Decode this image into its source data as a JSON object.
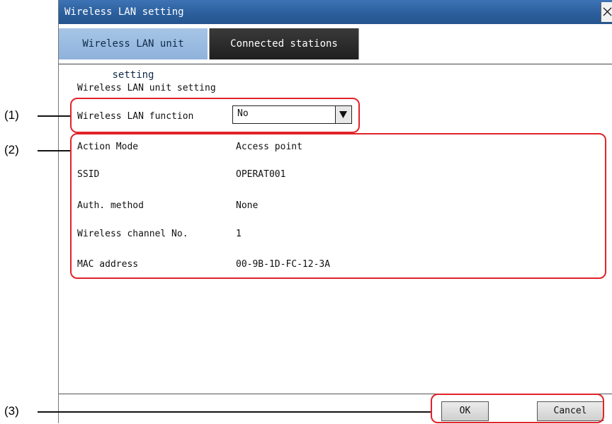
{
  "window": {
    "title": "Wireless LAN setting"
  },
  "tabs": [
    {
      "label": "Wireless LAN unit setting",
      "active": true
    },
    {
      "label": "Connected stations",
      "active": false
    }
  ],
  "section_title": "Wireless LAN unit setting",
  "wireless_function": {
    "label": "Wireless LAN function",
    "value": "No"
  },
  "info_rows": [
    {
      "label": "Action Mode",
      "value": "Access point"
    },
    {
      "label": "SSID",
      "value": "OPERAT001"
    },
    {
      "label": "Auth. method",
      "value": "None"
    },
    {
      "label": "Wireless channel No.",
      "value": "1"
    },
    {
      "label": "MAC address",
      "value": "00-9B-1D-FC-12-3A"
    }
  ],
  "buttons": {
    "ok": "OK",
    "cancel": "Cancel"
  },
  "callouts": [
    "(1)",
    "(2)",
    "(3)"
  ],
  "colors": {
    "titlebar": "#2b5f9c",
    "active_tab": "#8fb2dc",
    "inactive_tab": "#1f1f1f",
    "callout_border": "#e2232a"
  },
  "icons": {
    "close": "close-icon",
    "dropdown": "triangle-down-icon"
  }
}
